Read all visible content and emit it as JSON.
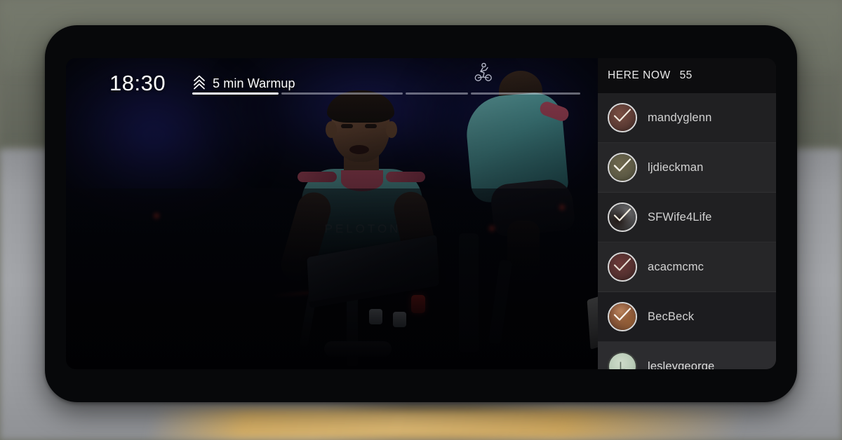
{
  "background": {
    "scene": "blurred-asphalt-road-with-yellow-center-line",
    "grass_color": "#6e7165",
    "road_color": "#a0a2a6",
    "line_color": "#d8b167"
  },
  "device": {
    "type": "tablet-landscape",
    "bezel_color": "#07080a"
  },
  "hud": {
    "clock": "18:30",
    "segment_label": "5 min Warmup",
    "chevron_icon": "double-chevron-up-icon",
    "cyclist_icon": "cyclist-icon",
    "progress": {
      "segments": [
        {
          "width_pct": 22,
          "fill_pct": 100
        },
        {
          "width_pct": 31,
          "fill_pct": 0
        },
        {
          "width_pct": 16,
          "fill_pct": 0
        },
        {
          "width_pct": 28,
          "fill_pct": 0
        }
      ],
      "overall_pct": 22
    }
  },
  "video": {
    "class_type": "peloton-cycling-studio-class",
    "instructor_jersey_text": "PELOTON",
    "jersey_color": "#55aaa9",
    "accent_color": "#c8546a"
  },
  "sidebar": {
    "title": "HERE NOW",
    "count": "55",
    "members": [
      {
        "name": "mandyglenn",
        "avatar_type": "photo",
        "avatar_color": "#5c3b34",
        "has_check": true,
        "shade": "shade-a"
      },
      {
        "name": "ljdieckman",
        "avatar_type": "photo",
        "avatar_color": "#5d5a45",
        "has_check": true,
        "shade": "shade-b"
      },
      {
        "name": "SFWife4Life",
        "avatar_type": "photo",
        "avatar_color": "#4a4a4c",
        "has_check": true,
        "shade": "shade-a"
      },
      {
        "name": "acacmcmc",
        "avatar_type": "photo",
        "avatar_color": "#54302f",
        "has_check": true,
        "shade": "shade-b"
      },
      {
        "name": "BecBeck",
        "avatar_type": "photo",
        "avatar_color": "#6b4430",
        "has_check": true,
        "shade": "shade-c"
      },
      {
        "name": "lesleygeorge_",
        "avatar_type": "letter",
        "avatar_color": "#b9cbb7",
        "letter": "L",
        "has_check": false,
        "shade": "shade-d"
      }
    ]
  }
}
